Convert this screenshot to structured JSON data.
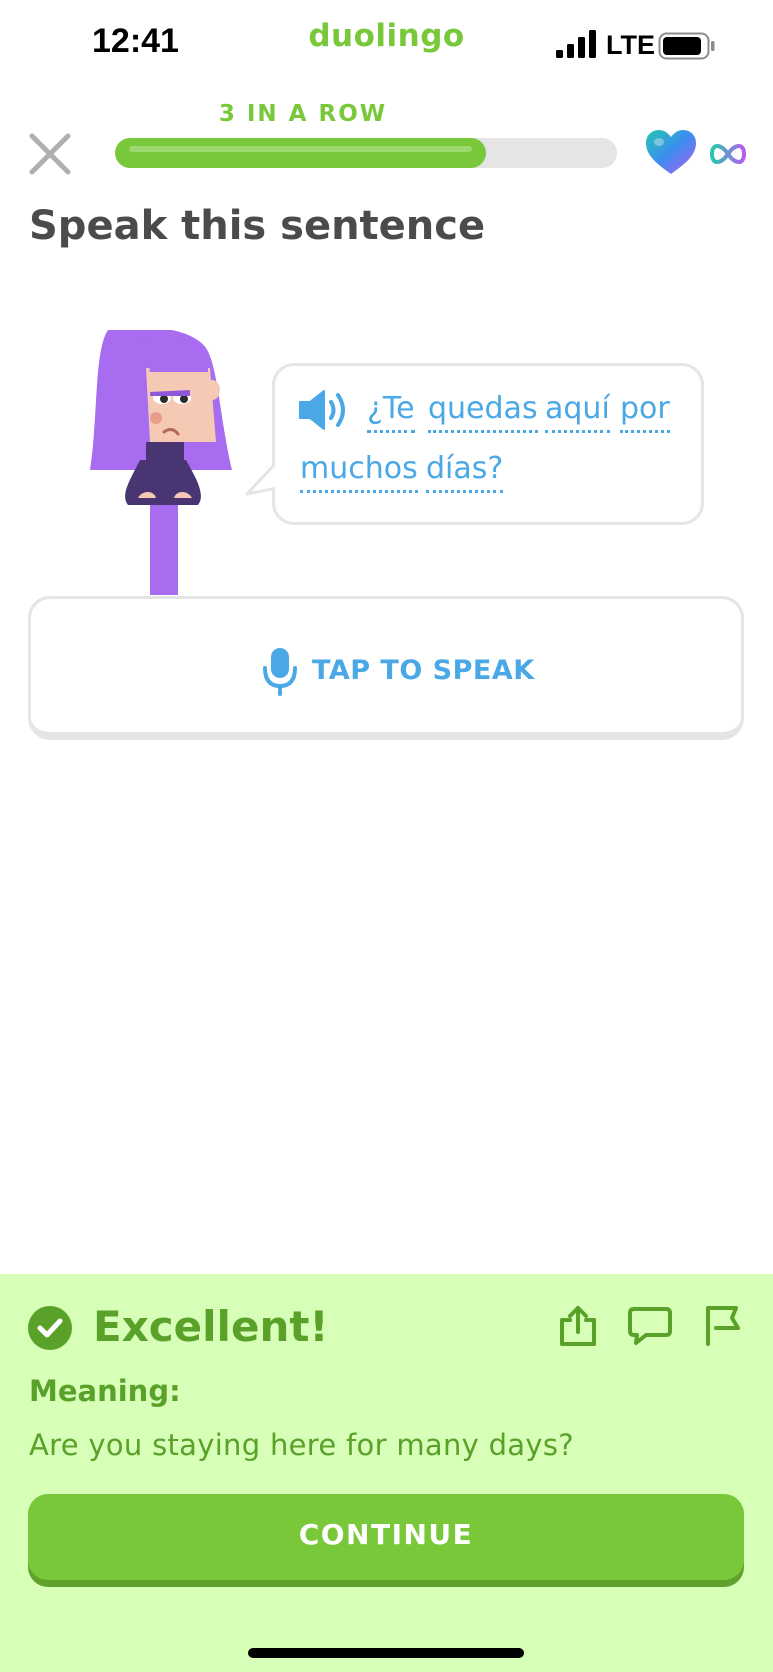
{
  "status_bar": {
    "time": "12:41",
    "network": "LTE"
  },
  "app": {
    "brand": "duolingo"
  },
  "header": {
    "streak_label": "3 IN A ROW",
    "progress": 0.74,
    "hearts": "∞"
  },
  "challenge": {
    "title": "Speak this sentence",
    "sentence_words": [
      "¿Te",
      "quedas",
      "aquí",
      "por",
      "muchos",
      "días?"
    ]
  },
  "speak_button": {
    "label": "TAP TO SPEAK"
  },
  "feedback": {
    "heading": "Excellent!",
    "meaning_label": "Meaning:",
    "meaning_text": "Are you staying here for many days?",
    "continue_label": "CONTINUE"
  },
  "colors": {
    "green": "#78c83a",
    "feedback_bg": "#d7ffb8",
    "blue": "#4aa8e6",
    "gray_border": "#e5e5e5",
    "purple": "#a76cf0"
  }
}
